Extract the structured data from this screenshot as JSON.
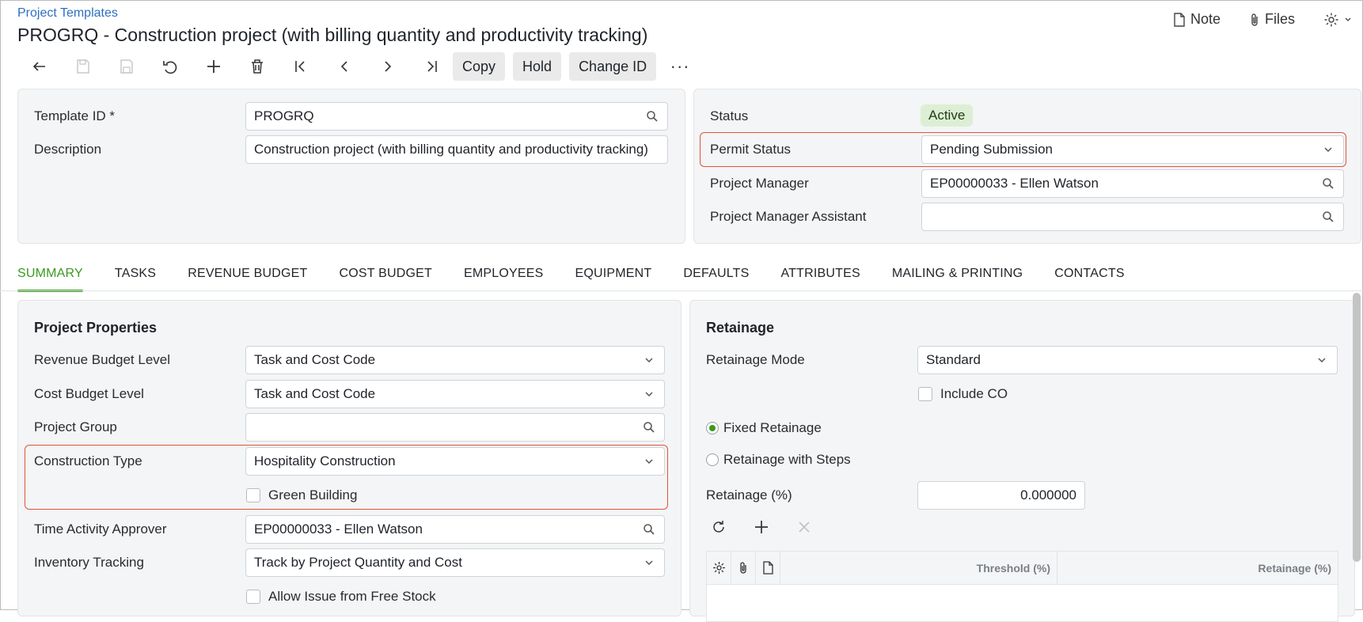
{
  "header": {
    "breadcrumb": "Project Templates",
    "title": "PROGRQ - Construction project (with billing quantity and productivity tracking)",
    "note_label": "Note",
    "files_label": "Files"
  },
  "toolbar": {
    "copy_label": "Copy",
    "hold_label": "Hold",
    "change_id_label": "Change ID",
    "more_label": "···"
  },
  "summary_left": {
    "template_id_label": "Template ID *",
    "template_id_value": "PROGRQ",
    "description_label": "Description",
    "description_value": "Construction project (with billing quantity and productivity tracking)"
  },
  "summary_right": {
    "status_label": "Status",
    "status_value": "Active",
    "permit_status_label": "Permit Status",
    "permit_status_value": "Pending Submission",
    "project_manager_label": "Project Manager",
    "project_manager_value": "EP00000033 - Ellen Watson",
    "pm_assistant_label": "Project Manager Assistant",
    "pm_assistant_value": ""
  },
  "tabs": [
    {
      "label": "SUMMARY",
      "active": true
    },
    {
      "label": "TASKS"
    },
    {
      "label": "REVENUE BUDGET"
    },
    {
      "label": "COST BUDGET"
    },
    {
      "label": "EMPLOYEES"
    },
    {
      "label": "EQUIPMENT"
    },
    {
      "label": "DEFAULTS"
    },
    {
      "label": "ATTRIBUTES"
    },
    {
      "label": "MAILING & PRINTING"
    },
    {
      "label": "CONTACTS"
    }
  ],
  "project_properties": {
    "title": "Project Properties",
    "revenue_budget_level_label": "Revenue Budget Level",
    "revenue_budget_level_value": "Task and Cost Code",
    "cost_budget_level_label": "Cost Budget Level",
    "cost_budget_level_value": "Task and Cost Code",
    "project_group_label": "Project Group",
    "project_group_value": "",
    "construction_type_label": "Construction Type",
    "construction_type_value": "Hospitality Construction",
    "green_building_label": "Green Building",
    "time_activity_approver_label": "Time Activity Approver",
    "time_activity_approver_value": "EP00000033 - Ellen Watson",
    "inventory_tracking_label": "Inventory Tracking",
    "inventory_tracking_value": "Track by Project Quantity and Cost",
    "allow_issue_label": "Allow Issue from Free Stock"
  },
  "retainage": {
    "title": "Retainage",
    "mode_label": "Retainage Mode",
    "mode_value": "Standard",
    "include_co_label": "Include CO",
    "fixed_label": "Fixed Retainage",
    "steps_label": "Retainage with Steps",
    "pct_label": "Retainage (%)",
    "pct_value": "0.000000",
    "grid_col_threshold": "Threshold (%)",
    "grid_col_retainage": "Retainage (%)"
  },
  "colors": {
    "accent": "#3a9a1e",
    "highlight": "#e2533a",
    "link": "#2d6fbf"
  }
}
